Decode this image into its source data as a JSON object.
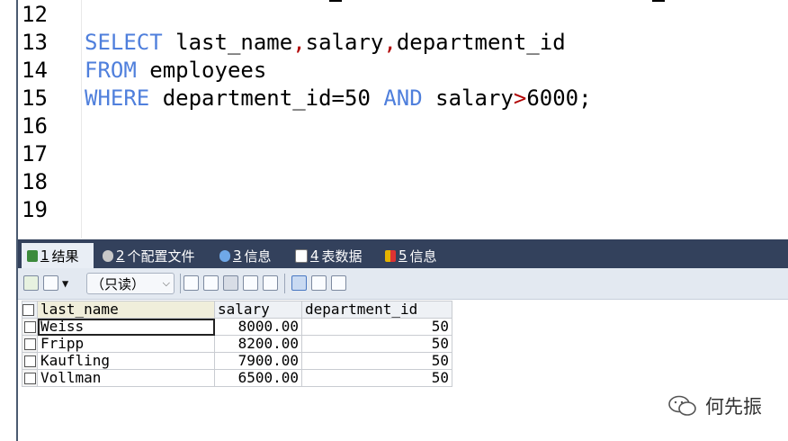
{
  "editor": {
    "lines": [
      {
        "num": "12"
      },
      {
        "num": "13"
      },
      {
        "num": "14"
      },
      {
        "num": "15"
      },
      {
        "num": "16"
      },
      {
        "num": "17"
      },
      {
        "num": "18"
      },
      {
        "num": "19"
      }
    ],
    "line13": {
      "kw": "SELECT",
      "a": " last_name",
      "c1": ",",
      "b": "salary",
      "c2": ",",
      "c": "department_id"
    },
    "line14": {
      "kw": "FROM",
      "a": " employees"
    },
    "line15": {
      "kw": "WHERE",
      "a": " department_id=50 ",
      "kw2": "AND",
      "b": " salary",
      "gt": ">",
      "c": "6000;"
    }
  },
  "tabs": [
    {
      "num": "1",
      "label": "结果"
    },
    {
      "num": "2",
      "label": "个配置文件"
    },
    {
      "num": "3",
      "label": "信息"
    },
    {
      "num": "4",
      "label": "表数据"
    },
    {
      "num": "5",
      "label": "信息"
    }
  ],
  "toolbar": {
    "readonly_label": "（只读）"
  },
  "results": {
    "columns": [
      "last_name",
      "salary",
      "department_id"
    ],
    "rows": [
      [
        "Weiss",
        "8000.00",
        "50"
      ],
      [
        "Fripp",
        "8200.00",
        "50"
      ],
      [
        "Kaufling",
        "7900.00",
        "50"
      ],
      [
        "Vollman",
        "6500.00",
        "50"
      ]
    ]
  },
  "watermark": {
    "text": "何先振"
  },
  "colors": {
    "keyword": "#4f7fdc",
    "operator": "#b00000",
    "tabbar": "#33415c"
  }
}
